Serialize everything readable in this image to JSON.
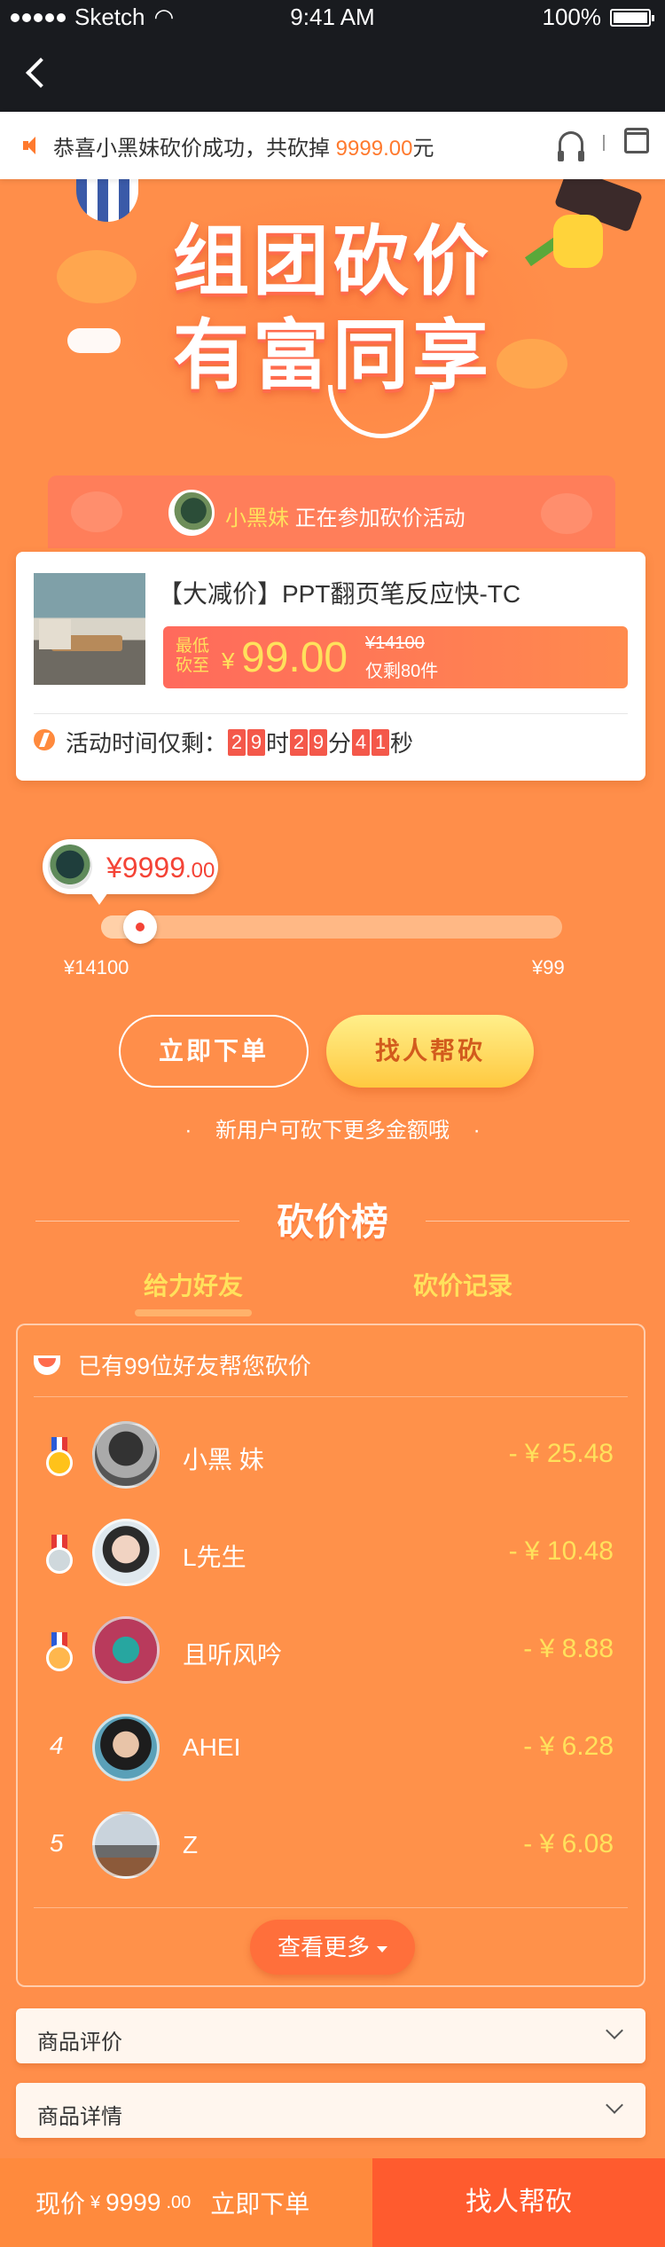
{
  "status_bar": {
    "carrier": "Sketch",
    "time": "9:41 AM",
    "battery": "100%"
  },
  "notice": {
    "text_before": "恭喜小黑妹砍价成功，共砍掉 ",
    "amount": "9999.00",
    "text_after": "元"
  },
  "banner": {
    "line1": "组团砍价",
    "line2": "有富同享"
  },
  "participant": {
    "name": "小黑妹",
    "text": " 正在参加砍价活动"
  },
  "product": {
    "title": "【大减价】PPT翻页笔反应快-TC",
    "low_label": "最低砍至",
    "currency": "¥",
    "price": "99.00",
    "original_price": "¥14100",
    "stock": "仅剩80件"
  },
  "timer": {
    "label": "活动时间仅剩：",
    "hours": [
      "2",
      "9"
    ],
    "h_unit": "时",
    "minutes": [
      "2",
      "9"
    ],
    "m_unit": "分",
    "seconds": [
      "4",
      "1"
    ],
    "s_unit": "秒"
  },
  "progress": {
    "current_amount": "¥9999",
    "current_cents": ".00",
    "start_label": "¥14100",
    "end_label": "¥99",
    "fraction": 0.06
  },
  "actions": {
    "order": "立即下单",
    "help": "找人帮砍",
    "hint": "新用户可砍下更多金额哦"
  },
  "ranking": {
    "title": "砍价榜",
    "tabs": [
      "给力好友",
      "砍价记录"
    ],
    "summary": "已有99位好友帮您砍价",
    "friends": [
      {
        "rank": "1",
        "name": "小黑 妹",
        "amount": "- ¥ 25.48"
      },
      {
        "rank": "2",
        "name": "L先生",
        "amount": "- ¥ 10.48"
      },
      {
        "rank": "3",
        "name": "且听风吟",
        "amount": "- ¥ 8.88"
      },
      {
        "rank": "4",
        "name": "AHEI",
        "amount": "- ¥ 6.28"
      },
      {
        "rank": "5",
        "name": "Z",
        "amount": "- ¥ 6.08"
      }
    ],
    "more": "查看更多"
  },
  "sections": {
    "reviews": "商品评价",
    "details": "商品详情"
  },
  "bottom_bar": {
    "price_label": "现价",
    "currency": "¥",
    "price": "9999",
    "cents": ".00",
    "order": "立即下单",
    "help": "找人帮砍"
  },
  "colors": {
    "accent": "#FF8E4A",
    "highlight": "#FFE15C",
    "red": "#F44336"
  }
}
